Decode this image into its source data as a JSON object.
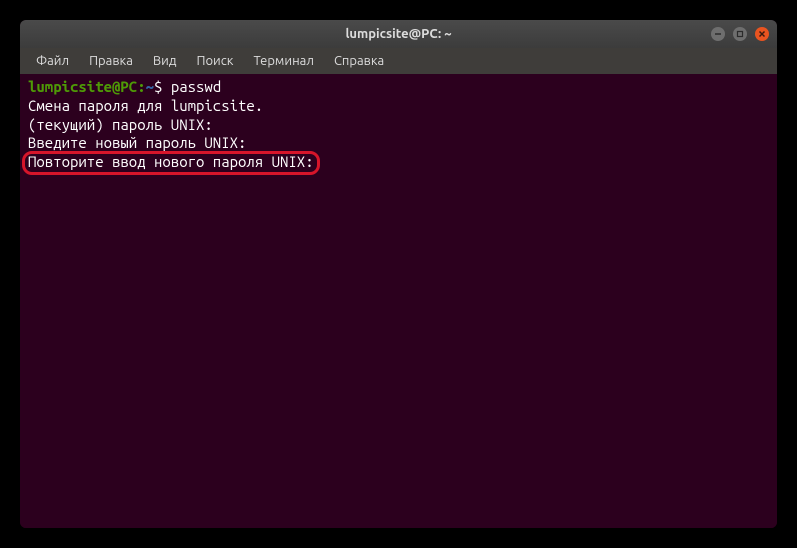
{
  "window": {
    "title": "lumpicsite@PC: ~"
  },
  "menubar": {
    "file": "Файл",
    "edit": "Правка",
    "view": "Вид",
    "search": "Поиск",
    "terminal": "Терминал",
    "help": "Справка"
  },
  "terminal": {
    "prompt_user": "lumpicsite@PC",
    "prompt_sep": ":",
    "prompt_path": "~",
    "prompt_dollar": "$",
    "command": "passwd",
    "lines": {
      "l1": "Смена пароля для lumpicsite.",
      "l2": "(текущий) пароль UNIX:",
      "l3": "Введите новый пароль UNIX:",
      "l4": "Повторите ввод нового пароля UNIX:"
    }
  }
}
